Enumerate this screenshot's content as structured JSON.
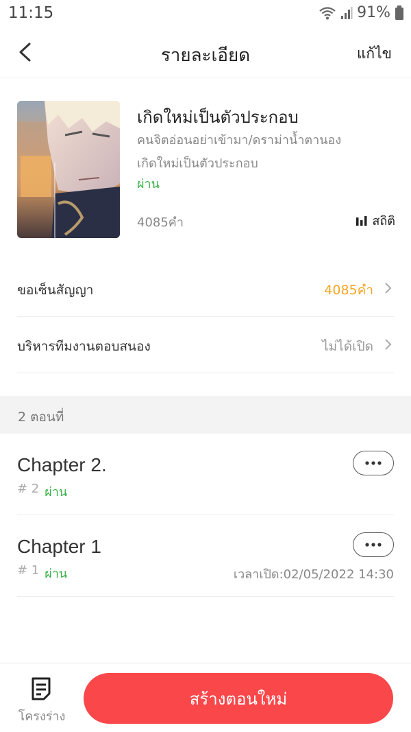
{
  "status_bar": {
    "time": "11:15",
    "battery": "91%"
  },
  "header": {
    "title": "รายละเอียด",
    "edit_label": "แก้ไข"
  },
  "book": {
    "title": "เกิดใหม่เป็นตัวประกอบ",
    "genre": "คนจิตอ่อนอย่าเข้ามา/ดราม่าน้ำตานอง",
    "subtitle": "เกิดใหม่เป็นตัวประกอบ",
    "status": "ผ่าน",
    "word_count": "4085คำ",
    "stats_label": "สถิติ"
  },
  "settings_rows": [
    {
      "label": "ขอเซ็นสัญญา",
      "value": "4085คำ",
      "value_color": "#f5a623"
    },
    {
      "label": "บริหารทีมงานตอบสนอง",
      "value": "ไม่ได้เปิด",
      "value_color": "#999999"
    }
  ],
  "chapters_section": {
    "label": "2 ตอนที่"
  },
  "chapters": [
    {
      "title": "Chapter 2.",
      "number": "# 2",
      "status": "ผ่าน",
      "time": ""
    },
    {
      "title": "Chapter 1",
      "number": "# 1",
      "status": "ผ่าน",
      "time": "เวลาเปิด:02/05/2022 14:30"
    }
  ],
  "bottom_bar": {
    "outline_label": "โครงร่าง",
    "create_label": "สร้างตอนใหม่"
  },
  "colors": {
    "accent_red": "#f9474a",
    "status_green": "#3bb34a",
    "contract_orange": "#f5a623"
  },
  "icons": [
    "back-arrow-icon",
    "wifi-icon",
    "signal-icon",
    "battery-icon",
    "stats-bar-icon",
    "chevron-right-icon",
    "more-dots-icon",
    "outline-document-icon"
  ]
}
